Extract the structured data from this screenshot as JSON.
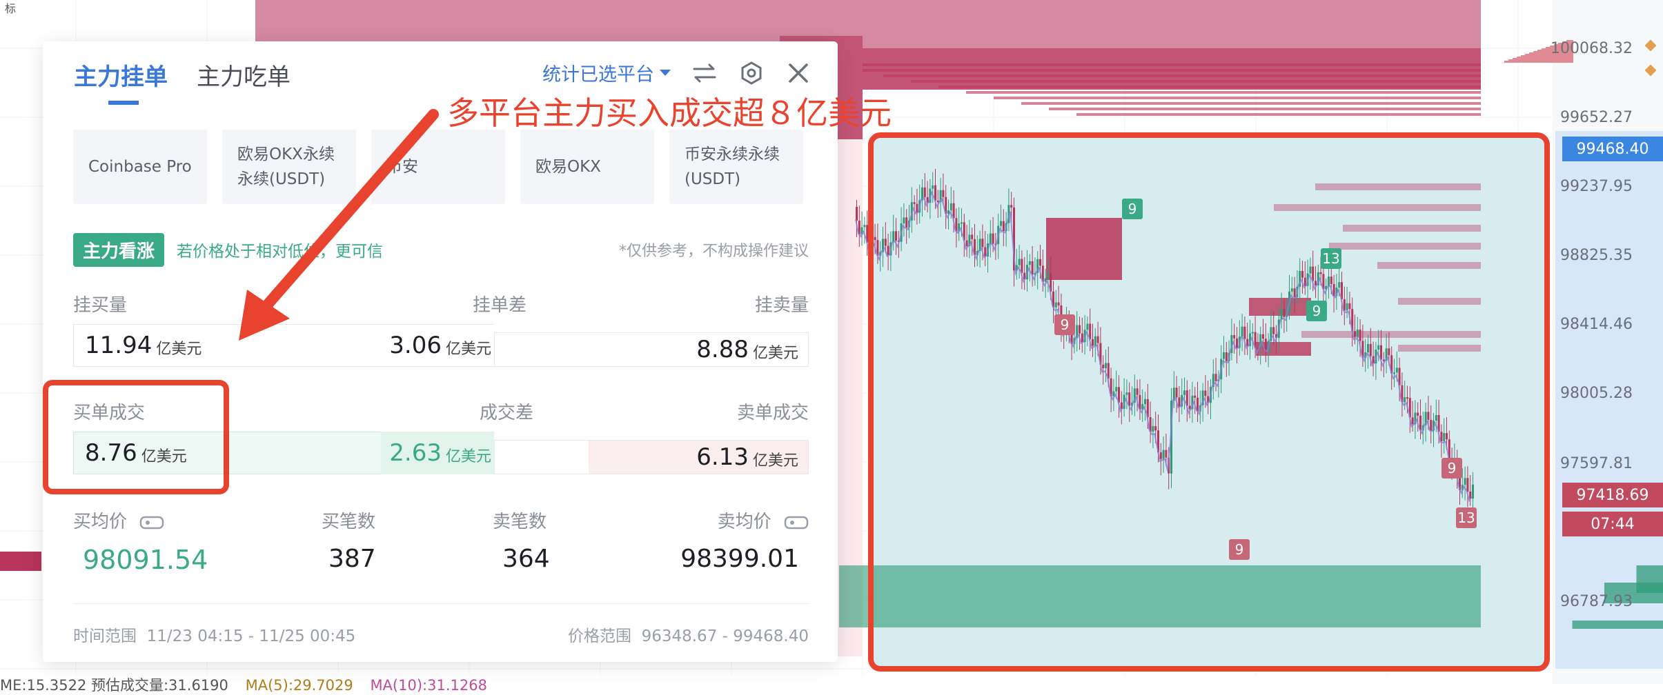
{
  "chart": {
    "price_axis": [
      "100068.32",
      "99652.27",
      "99237.95",
      "98825.35",
      "98414.46",
      "98005.28",
      "97597.81",
      "96787.93"
    ],
    "price_tags": [
      {
        "text": "99468.40",
        "color": "#3b86e0"
      },
      {
        "text": "97418.69",
        "color": "#c14a5e"
      },
      {
        "text": "07:44",
        "color": "#c14a5e"
      }
    ],
    "seq_badges": [
      "9",
      "13",
      "9",
      "9",
      "9",
      "13",
      "9",
      "13"
    ],
    "bottom_stats": {
      "vol": "ME:15.3522  预估成交量:31.6190",
      "ma5": "MA(5):29.7029",
      "ma10": "MA(10):31.1268"
    },
    "up_color": "#2f9b78",
    "down_color": "#b8345a"
  },
  "panel": {
    "tabs": [
      "主力挂单",
      "主力吃单"
    ],
    "platform_select": "统计已选平台",
    "icons": [
      "swap-icon",
      "settings-icon",
      "close-icon"
    ],
    "platforms": [
      "Coinbase Pro",
      "欧易OKX永续\n永续(USDT)",
      "币安",
      "欧易OKX",
      "币安永续永续\n(USDT)"
    ],
    "trend_badge": "主力看涨",
    "trend_hint": "若价格处于相对低位，更可信",
    "trend_note": "*仅供参考，不构成操作建议",
    "orders": {
      "headers": [
        "挂买量",
        "挂单差",
        "挂卖量"
      ],
      "buy": "11.94",
      "diff": "3.06",
      "sell": "8.88",
      "unit": "亿美元"
    },
    "fills": {
      "headers": [
        "买单成交",
        "成交差",
        "卖单成交"
      ],
      "buy": "8.76",
      "diff": "2.63",
      "sell": "6.13",
      "unit": "亿美元"
    },
    "stats": {
      "headers": [
        "买均价",
        "买笔数",
        "卖笔数",
        "卖均价"
      ],
      "buy_avg": "98091.54",
      "buy_count": "387",
      "sell_count": "364",
      "sell_avg": "98399.01"
    },
    "time_range_label": "时间范围",
    "time_range": "11/23 04:15 - 11/25 00:45",
    "price_range_label": "价格范围",
    "price_range": "96348.67 - 99468.40",
    "accent": "#3b77d6",
    "green": "#3aaa86"
  },
  "annotation": {
    "text": "多平台主力买入成交超８亿美元",
    "color": "#e8432e"
  }
}
